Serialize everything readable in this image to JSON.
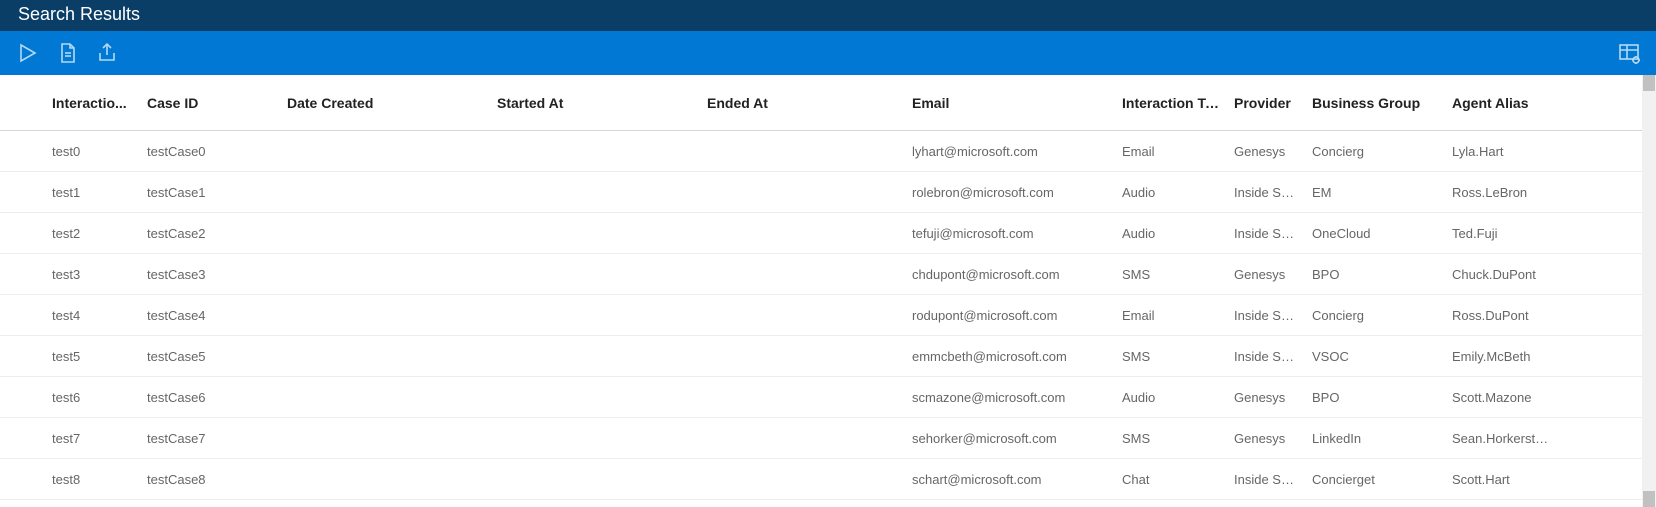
{
  "title": "Search Results",
  "columns": {
    "interaction": "Interactio...",
    "caseid": "Case ID",
    "date": "Date Created",
    "start": "Started At",
    "end": "Ended At",
    "email": "Email",
    "type": "Interaction Ty...",
    "provider": "Provider",
    "bgroup": "Business Group",
    "agent": "Agent Alias"
  },
  "rows": [
    {
      "interaction": "test0",
      "caseid": "testCase0",
      "date": "",
      "start": "",
      "end": "",
      "email": "lyhart@microsoft.com",
      "type": "Email",
      "provider": "Genesys",
      "bgroup": "Concierg",
      "agent": "Lyla.Hart"
    },
    {
      "interaction": "test1",
      "caseid": "testCase1",
      "date": "",
      "start": "",
      "end": "",
      "email": "rolebron@microsoft.com",
      "type": "Audio",
      "provider": "Inside Sal...",
      "bgroup": "EM",
      "agent": "Ross.LeBron"
    },
    {
      "interaction": "test2",
      "caseid": "testCase2",
      "date": "",
      "start": "",
      "end": "",
      "email": "tefuji@microsoft.com",
      "type": "Audio",
      "provider": "Inside Sal...",
      "bgroup": "OneCloud",
      "agent": "Ted.Fuji"
    },
    {
      "interaction": "test3",
      "caseid": "testCase3",
      "date": "",
      "start": "",
      "end": "",
      "email": "chdupont@microsoft.com",
      "type": "SMS",
      "provider": "Genesys",
      "bgroup": "BPO",
      "agent": "Chuck.DuPont"
    },
    {
      "interaction": "test4",
      "caseid": "testCase4",
      "date": "",
      "start": "",
      "end": "",
      "email": "rodupont@microsoft.com",
      "type": "Email",
      "provider": "Inside Sal...",
      "bgroup": "Concierg",
      "agent": "Ross.DuPont"
    },
    {
      "interaction": "test5",
      "caseid": "testCase5",
      "date": "",
      "start": "",
      "end": "",
      "email": "emmcbeth@microsoft.com",
      "type": "SMS",
      "provider": "Inside Sal...",
      "bgroup": "VSOC",
      "agent": "Emily.McBeth"
    },
    {
      "interaction": "test6",
      "caseid": "testCase6",
      "date": "",
      "start": "",
      "end": "",
      "email": "scmazone@microsoft.com",
      "type": "Audio",
      "provider": "Genesys",
      "bgroup": "BPO",
      "agent": "Scott.Mazone"
    },
    {
      "interaction": "test7",
      "caseid": "testCase7",
      "date": "",
      "start": "",
      "end": "",
      "email": "sehorker@microsoft.com",
      "type": "SMS",
      "provider": "Genesys",
      "bgroup": "LinkedIn",
      "agent": "Sean.Horkerstork..."
    },
    {
      "interaction": "test8",
      "caseid": "testCase8",
      "date": "",
      "start": "",
      "end": "",
      "email": "schart@microsoft.com",
      "type": "Chat",
      "provider": "Inside Sal...",
      "bgroup": "Concierget",
      "agent": "Scott.Hart"
    }
  ]
}
